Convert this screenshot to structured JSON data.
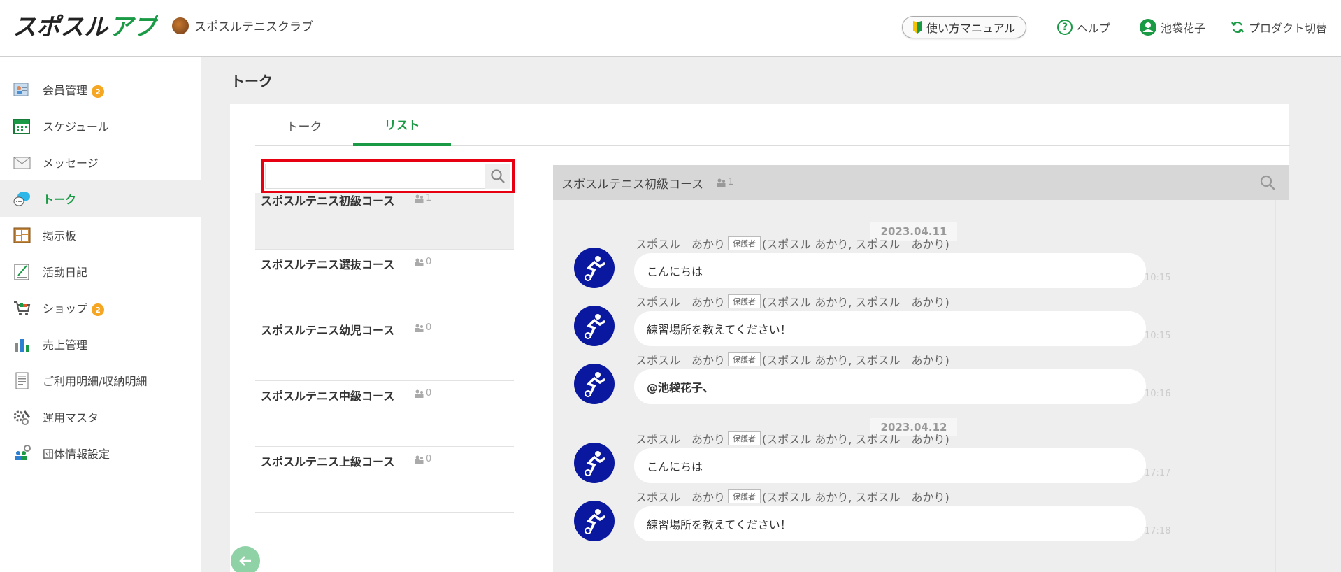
{
  "header": {
    "logo_text": "スポスルアプリ",
    "club_name": "スポスルテニスクラブ",
    "manual_label": "使い方マニュアル",
    "help_label": "ヘルプ",
    "user_name": "池袋花子",
    "product_switch_label": "プロダクト切替"
  },
  "sidebar": {
    "items": [
      {
        "label": "会員管理",
        "icon": "members-icon",
        "badge": "2"
      },
      {
        "label": "スケジュール",
        "icon": "calendar-icon"
      },
      {
        "label": "メッセージ",
        "icon": "mail-icon"
      },
      {
        "label": "トーク",
        "icon": "chat-bubble-icon",
        "active": true
      },
      {
        "label": "掲示板",
        "icon": "board-icon"
      },
      {
        "label": "活動日記",
        "icon": "diary-icon"
      },
      {
        "label": "ショップ",
        "icon": "cart-icon",
        "badge": "2"
      },
      {
        "label": "売上管理",
        "icon": "sales-chart-icon"
      },
      {
        "label": "ご利用明細/収納明細",
        "icon": "receipt-icon"
      },
      {
        "label": "運用マスタ",
        "icon": "gears-icon"
      },
      {
        "label": "団体情報設定",
        "icon": "group-settings-icon"
      }
    ]
  },
  "page": {
    "title": "トーク",
    "tabs": [
      {
        "label": "トーク"
      },
      {
        "label": "リスト",
        "active": true
      }
    ],
    "search": {
      "value": "",
      "placeholder": ""
    }
  },
  "rooms": [
    {
      "name": "スポスルテニス初級コース",
      "count": "1",
      "selected": true
    },
    {
      "name": "スポスルテニス選抜コース",
      "count": "0"
    },
    {
      "name": "スポスルテニス幼児コース",
      "count": "0"
    },
    {
      "name": "スポスルテニス中級コース",
      "count": "0"
    },
    {
      "name": "スポスルテニス上級コース",
      "count": "0"
    }
  ],
  "chat": {
    "title": "スポスルテニス初級コース",
    "member_count": "1",
    "dates": [
      "2023.04.11",
      "2023.04.12"
    ],
    "messages": [
      {
        "sender": "スポスル　あかり",
        "tag": "保護者",
        "detail": "(スポスル あかり, スポスル　あかり)",
        "text": "こんにちは",
        "time": "10:15"
      },
      {
        "sender": "スポスル　あかり",
        "tag": "保護者",
        "detail": "(スポスル あかり, スポスル　あかり)",
        "text": "練習場所を教えてください！",
        "time": "10:15"
      },
      {
        "sender": "スポスル　あかり",
        "tag": "保護者",
        "detail": "(スポスル あかり, スポスル　あかり)",
        "text": "@池袋花子、",
        "time": "10:16"
      },
      {
        "sender": "スポスル　あかり",
        "tag": "保護者",
        "detail": "(スポスル あかり, スポスル　あかり)",
        "text": "こんにちは",
        "time": "17:17"
      },
      {
        "sender": "スポスル　あかり",
        "tag": "保護者",
        "detail": "(スポスル あかり, スポスル　あかり)",
        "text": "練習場所を教えてください！",
        "time": "17:18"
      }
    ]
  },
  "colors": {
    "brand_green": "#1a9a45",
    "highlight_red": "#e60012",
    "badge_orange": "#f5a623",
    "avatar_navy": "#0a18a0"
  }
}
